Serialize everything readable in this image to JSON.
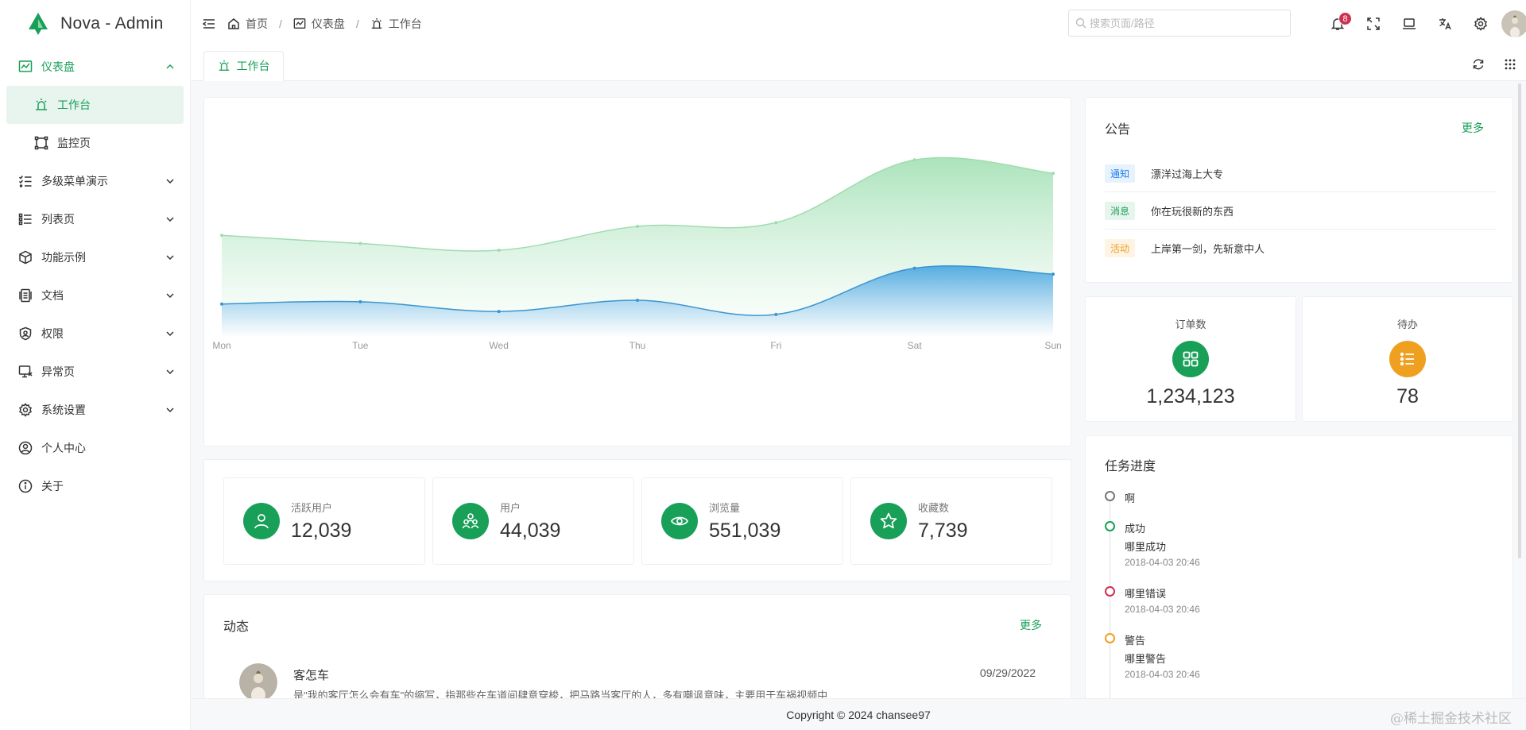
{
  "app": {
    "title": "Nova - Admin"
  },
  "sidebar": {
    "items": [
      {
        "label": "仪表盘"
      },
      {
        "label": "工作台"
      },
      {
        "label": "监控页"
      },
      {
        "label": "多级菜单演示"
      },
      {
        "label": "列表页"
      },
      {
        "label": "功能示例"
      },
      {
        "label": "文档"
      },
      {
        "label": "权限"
      },
      {
        "label": "异常页"
      },
      {
        "label": "系统设置"
      },
      {
        "label": "个人中心"
      },
      {
        "label": "关于"
      }
    ]
  },
  "header": {
    "breadcrumbs": [
      "首页",
      "仪表盘",
      "工作台"
    ],
    "search_placeholder": "搜索页面/路径",
    "notification_count": "8"
  },
  "tabs": [
    {
      "label": "工作台"
    }
  ],
  "chart_data": {
    "type": "area",
    "categories": [
      "Mon",
      "Tue",
      "Wed",
      "Thu",
      "Fri",
      "Sat",
      "Sun"
    ],
    "ylim": [
      0,
      300
    ],
    "series": [
      {
        "values": [
          137,
          126,
          117,
          149,
          154,
          238,
          220
        ],
        "color": "#8ed6a3"
      },
      {
        "values": [
          45,
          48,
          35,
          50,
          31,
          93,
          85
        ],
        "color": "#4aa4dc"
      }
    ]
  },
  "stats": [
    {
      "label": "活跃用户",
      "value": "12,039",
      "icon": "user-icon"
    },
    {
      "label": "用户",
      "value": "44,039",
      "icon": "users-icon"
    },
    {
      "label": "浏览量",
      "value": "551,039",
      "icon": "eye-icon"
    },
    {
      "label": "收藏数",
      "value": "7,739",
      "icon": "star-icon"
    }
  ],
  "activity": {
    "title": "动态",
    "more": "更多",
    "items": [
      {
        "name": "客怎车",
        "date": "09/29/2022",
        "desc": "是\"我的客厅怎么会有车\"的缩写，指那些在车道间肆意穿梭，把马路当客厅的人，多有嘲讽意味，主要用于车祸视频中"
      }
    ]
  },
  "notice": {
    "title": "公告",
    "more": "更多",
    "items": [
      {
        "tag": "通知",
        "text": "漂洋过海上大专",
        "color": "#2080f0",
        "bg": "#e8f2fe"
      },
      {
        "tag": "消息",
        "text": "你在玩很新的东西",
        "color": "#18a058",
        "bg": "#e7f5ee"
      },
      {
        "tag": "活动",
        "text": "上岸第一剑，先斩意中人",
        "color": "#f0a020",
        "bg": "#fef4e6"
      }
    ]
  },
  "orders": {
    "label": "订单数",
    "value": "1,234,123",
    "color": "#18a058"
  },
  "todo": {
    "label": "待办",
    "value": "78",
    "color": "#f0a020"
  },
  "tasks": {
    "title": "任务进度",
    "items": [
      {
        "title": "啊",
        "color": "#777777"
      },
      {
        "title": "成功",
        "content": "哪里成功",
        "time": "2018-04-03 20:46",
        "color": "#18a058"
      },
      {
        "title": "哪里错误",
        "time": "2018-04-03 20:46",
        "color": "#d03050"
      },
      {
        "title": "警告",
        "content": "哪里警告",
        "time": "2018-04-03 20:46",
        "color": "#f0a020"
      }
    ]
  },
  "footer": {
    "text": "Copyright © 2024 chansee97"
  },
  "watermark": "@稀土掘金技术社区"
}
